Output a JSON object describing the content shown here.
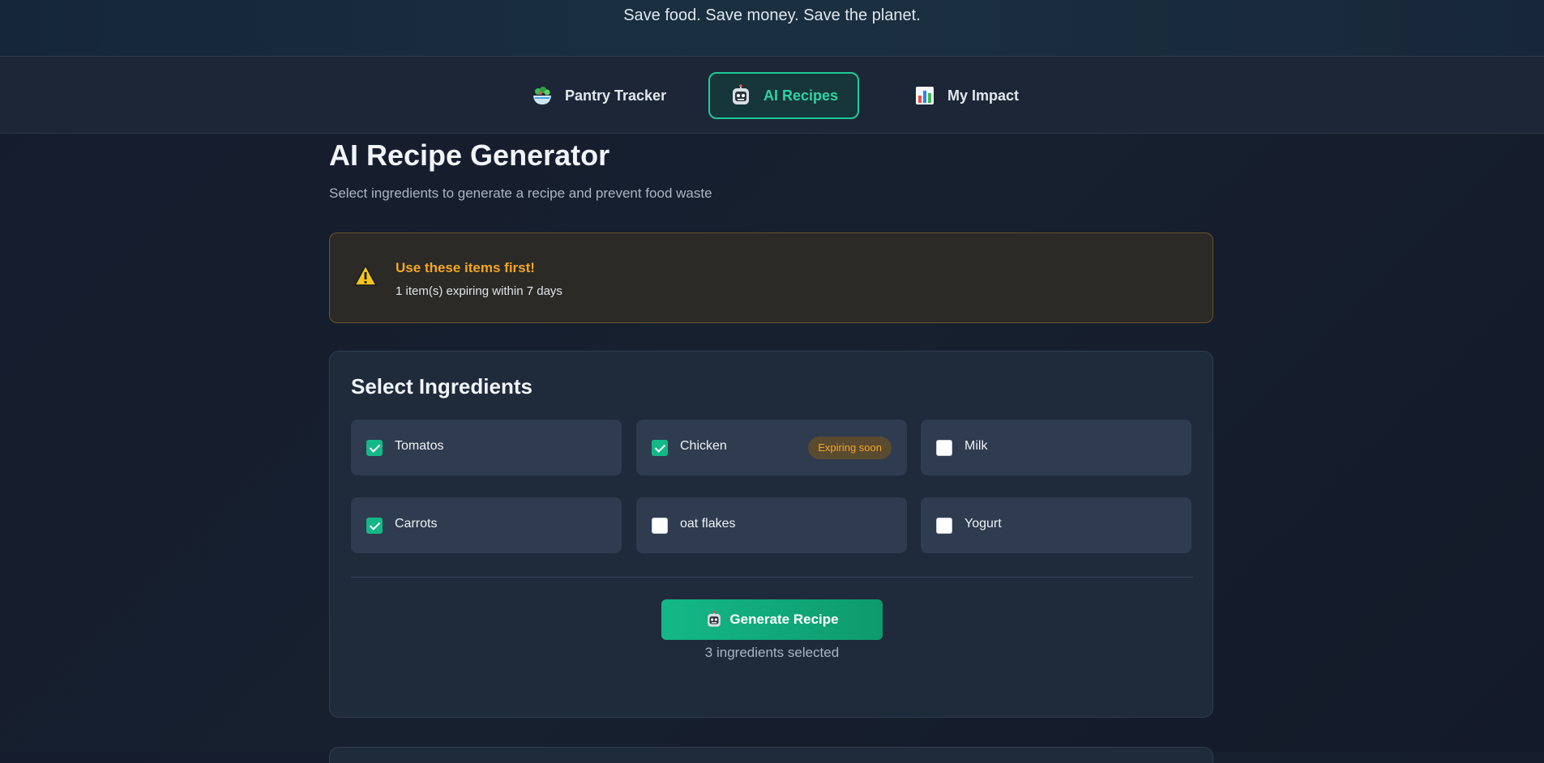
{
  "header": {
    "tagline": "Save food. Save money. Save the planet."
  },
  "nav": {
    "tabs": [
      {
        "label": "Pantry Tracker",
        "icon": "salad-bowl-icon",
        "active": false
      },
      {
        "label": "AI Recipes",
        "icon": "robot-icon",
        "active": true
      },
      {
        "label": "My Impact",
        "icon": "bar-chart-icon",
        "active": false
      }
    ]
  },
  "main": {
    "title": "AI Recipe Generator",
    "subtitle": "Select ingredients to generate a recipe and prevent food waste",
    "alert": {
      "icon": "warning-icon",
      "title": "Use these items first!",
      "text": "1 item(s) expiring within 7 days"
    },
    "ingredients_panel": {
      "title": "Select Ingredients",
      "items": [
        {
          "name": "Tomatos",
          "checked": true,
          "badge": ""
        },
        {
          "name": "Chicken",
          "checked": true,
          "badge": "Expiring soon"
        },
        {
          "name": "Milk",
          "checked": false,
          "badge": ""
        },
        {
          "name": "Carrots",
          "checked": true,
          "badge": ""
        },
        {
          "name": "oat flakes",
          "checked": false,
          "badge": ""
        },
        {
          "name": "Yogurt",
          "checked": false,
          "badge": ""
        }
      ],
      "generate_label": "Generate Recipe",
      "selected_count": "3 ingredients selected"
    }
  },
  "colors": {
    "accent": "#20c997",
    "warning": "#f5a623",
    "background": "#151c2e"
  }
}
